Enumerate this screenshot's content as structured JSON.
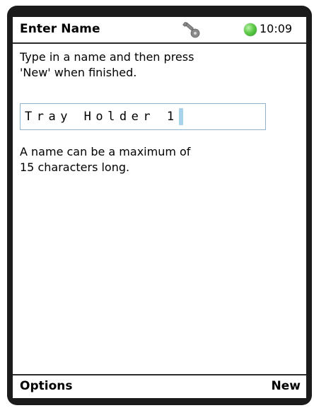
{
  "header": {
    "title": "Enter Name",
    "time": "10:09",
    "icons": [
      "key-icon",
      "status-online-icon"
    ],
    "status_color": "#4caf3f"
  },
  "instructions": "Type in a name and then press\n'New' when finished.",
  "name_field": {
    "value": "Tray Holder 1"
  },
  "hint": "A name can be a maximum of\n15 characters long.",
  "softkeys": {
    "left": "Options",
    "right": "New"
  }
}
